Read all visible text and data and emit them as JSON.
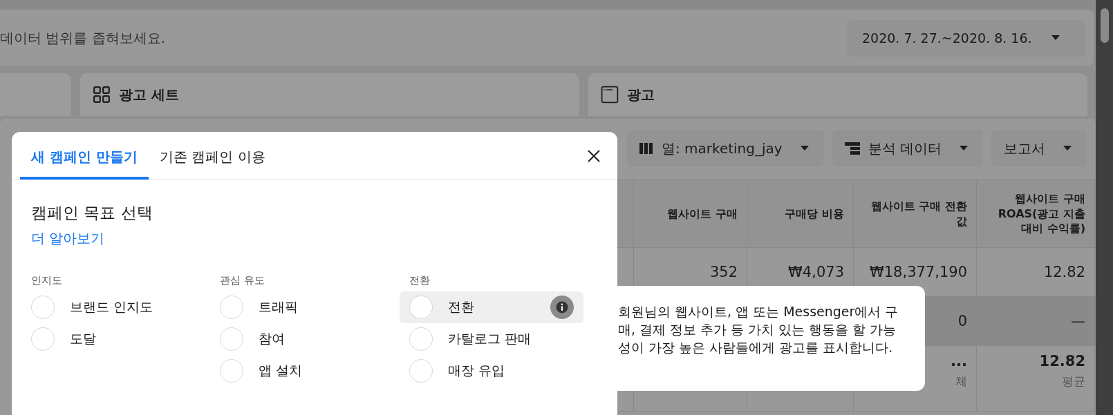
{
  "filter_bar": {
    "hint": "데이터 범위를 좁혀보세요.",
    "date_range": "2020. 7. 27.~2020. 8. 16."
  },
  "level_tabs": [
    {
      "label": "광고 세트",
      "kind": "grid"
    },
    {
      "label": "광고",
      "kind": "window"
    }
  ],
  "toolbar": [
    {
      "label": "열: marketing_jay",
      "kind": "columns"
    },
    {
      "label": "분석 데이터",
      "kind": "breakdown"
    },
    {
      "label": "보고서",
      "kind": "plain"
    }
  ],
  "table": {
    "columns": [
      "웹사이트 구매",
      "구매당 비용",
      "웹사이트 구매 전환값",
      "웹사이트 구매 ROAS(광고 지출 대비 수익률)"
    ],
    "rows": [
      {
        "shaded": false,
        "total": false,
        "cells": [
          {
            "value": "352"
          },
          {
            "value": "₩4,073"
          },
          {
            "value": "₩18,377,190"
          },
          {
            "value": "12.82"
          }
        ]
      },
      {
        "shaded": true,
        "total": false,
        "cells": [
          null,
          null,
          {
            "value": "0"
          },
          {
            "value": "—"
          }
        ]
      },
      {
        "shaded": false,
        "total": true,
        "cells": [
          null,
          null,
          {
            "value": "...",
            "note": "체"
          },
          {
            "value": "12.82",
            "note": "평균"
          }
        ]
      }
    ]
  },
  "modal": {
    "tabs": [
      {
        "label": "새 캠페인 만들기",
        "selected": true
      },
      {
        "label": "기존 캠페인 이용",
        "selected": false
      }
    ],
    "heading": "캠페인 목표 선택",
    "link": "더 알아보기",
    "groups": [
      {
        "title": "인지도",
        "options": [
          {
            "label": "브랜드 인지도",
            "selected": false,
            "highlighted": false
          },
          {
            "label": "도달",
            "selected": false,
            "highlighted": false
          }
        ]
      },
      {
        "title": "관심 유도",
        "options": [
          {
            "label": "트래픽",
            "selected": false,
            "highlighted": false
          },
          {
            "label": "참여",
            "selected": false,
            "highlighted": false
          },
          {
            "label": "앱 설치",
            "selected": false,
            "highlighted": false
          }
        ]
      },
      {
        "title": "전환",
        "options": [
          {
            "label": "전환",
            "selected": false,
            "highlighted": true
          },
          {
            "label": "카탈로그 판매",
            "selected": false,
            "highlighted": false
          },
          {
            "label": "매장 유입",
            "selected": false,
            "highlighted": false
          }
        ]
      }
    ]
  },
  "tooltip": "회원님의 웹사이트, 앱 또는 Messenger에서 구매, 결제 정보 추가 등 가치 있는 행동을 할 가능성이 가장 높은 사람들에게 광고를 표시합니다."
}
